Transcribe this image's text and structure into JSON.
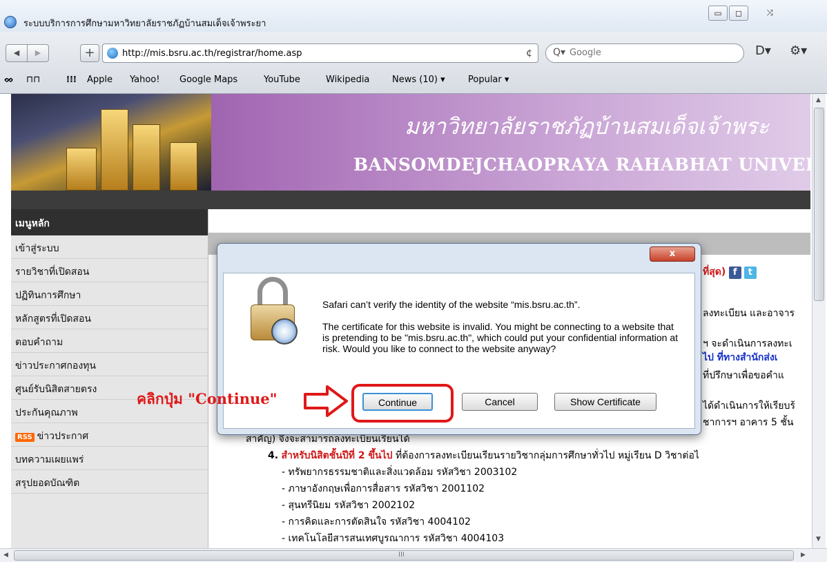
{
  "window": {
    "title": "ระบบบริการการศึกษามหาวิทยาลัยราชภัฏบ้านสมเด็จเจ้าพระยา",
    "minimize": "▭",
    "maximize": "◻",
    "close": "⤨"
  },
  "toolbar": {
    "back": "◀",
    "forward": "▶",
    "add": "+",
    "url": "http://mis.bsru.ac.th/registrar/home.asp",
    "reload": "¢",
    "search_placeholder": "Google",
    "page_icon": "D▾",
    "gear_icon": "⚙▾"
  },
  "bookmarks": {
    "glasses": "ᨖ",
    "book": "⊓⊓",
    "grid": "⁞⁞⁞",
    "items": [
      "Apple",
      "Yahoo!",
      "Google Maps",
      "YouTube",
      "Wikipedia",
      "News (10) ▾",
      "Popular ▾"
    ]
  },
  "banner": {
    "thai": "มหาวิทยาลัยราชภัฏบ้านสมเด็จเจ้าพระ",
    "english": "BANSOMDEJCHAOPRAYA RAHABHAT UNIVERS"
  },
  "sidebar": {
    "header": "เมนูหลัก",
    "items": [
      "เข้าสู่ระบบ",
      "รายวิชาที่เปิดสอน",
      "ปฏิทินการศึกษา",
      "หลักสูตรที่เปิดสอน",
      "ตอบคำถาม",
      "ข่าวประกาศกองทุน",
      "ศูนย์รับนิสิตสายตรง",
      "ประกันคุณภาพ",
      "ข่าวประกาศ",
      "บทความเผยแพร่",
      "สรุปยอดบัณฑิต"
    ],
    "rss": "RSS"
  },
  "content": {
    "news_end": "ที่สุด)",
    "fb": "f",
    "tw": "t",
    "frag1": "ลงทะเบียน และอาจาร",
    "frag2": "ฯ จะดำเนินการลงทะเ",
    "frag3": "ไป ที่ทางสำนักส่งเ",
    "frag4": "ที่ปรึกษาเพื่อขอคำแ",
    "frag5": "ได้ดำเนินการให้เรียบร้",
    "frag6": "ชาการฯ อาคาร 5 ชั้น",
    "line7": "สาคัญ) จึงจะสามารถลงทะเบียนเรียนได้",
    "item4_num": "4.",
    "item4_red": "สำหรับนิสิตชั้นปีที่ 2 ขึ้นไป",
    "item4_rest": "ที่ต้องการลงทะเบียนเรียนรายวิชากลุ่มการศึกษาทั่วไป หมู่เรียน D วิชาต่อไ",
    "subjects": [
      "- ทรัพยากรธรรมชาติและสิ่งแวดล้อม รหัสวิชา 2003102",
      "- ภาษาอังกฤษเพื่อการสื่อสาร รหัสวิชา 2001102",
      "- สุนทรีนิยม รหัสวิชา 2002102",
      "- การคิดและการตัดสินใจ รหัสวิชา 4004102",
      "- เทคโนโลยีสารสนเทศบูรณาการ รหัสวิชา 4004103"
    ]
  },
  "dialog": {
    "close_label": "x",
    "heading": "Safari can’t verify the identity of the website “mis.bsru.ac.th”.",
    "message": "The certificate for this website is invalid. You might be connecting to a website that is pretending to be \"mis.bsru.ac.th\", which could put your confidential information at risk. Would you like to connect to the website anyway?",
    "continue": "Continue",
    "cancel": "Cancel",
    "show_certificate": "Show Certificate"
  },
  "annotation": {
    "text": "คลิกปุ่ม \"Continue\""
  },
  "scroll": {
    "up": "▲",
    "down": "▼",
    "left": "◀",
    "right": "▶",
    "grip": "III"
  }
}
